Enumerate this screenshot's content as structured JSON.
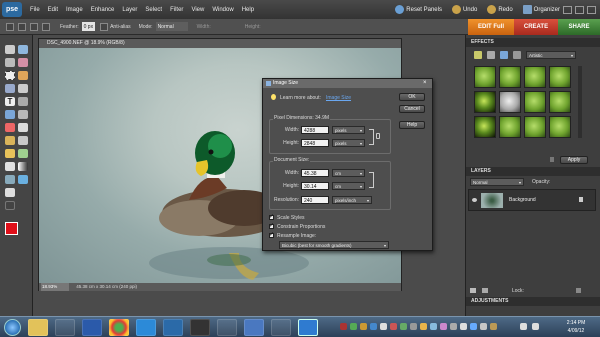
{
  "app": {
    "logo": "pse"
  },
  "menu": [
    "File",
    "Edit",
    "Image",
    "Enhance",
    "Layer",
    "Select",
    "Filter",
    "View",
    "Window",
    "Help"
  ],
  "menu_right": {
    "reset_panels": "Reset Panels",
    "undo": "Undo",
    "redo": "Redo",
    "organizer": "Organizer"
  },
  "options_bar": {
    "feather_label": "Feather:",
    "feather_value": "0 px",
    "antialias": "Anti-alias",
    "mode_label": "Mode:",
    "mode_value": "Normal",
    "width_label": "Width:",
    "height_label": "Height:"
  },
  "modes": {
    "edit": "EDIT Full",
    "create": "CREATE",
    "share": "SHARE"
  },
  "document": {
    "title": "DSC_4900.NEF @ 18.9% (RGB/8)",
    "zoom": "18.93%",
    "status": "45.38 cm x 30.14 cm (240 ppi)"
  },
  "dialog": {
    "title": "Image Size",
    "learn_more": "Learn more about:",
    "learn_more_link": "Image Size",
    "ok": "OK",
    "cancel": "Cancel",
    "help": "Help",
    "pixel_dimensions": "Pixel Dimensions: 34.9M",
    "px_width_label": "Width:",
    "px_width": "4288",
    "px_width_unit": "pixels",
    "px_height_label": "Height:",
    "px_height": "2848",
    "px_height_unit": "pixels",
    "doc_size": "Document Size:",
    "doc_width_label": "Width:",
    "doc_width": "45.38",
    "doc_width_unit": "cm",
    "doc_height_label": "Height:",
    "doc_height": "30.14",
    "doc_height_unit": "cm",
    "res_label": "Resolution:",
    "res_value": "240",
    "res_unit": "pixels/inch",
    "scale_styles": "Scale Styles",
    "constrain": "Constrain Proportions",
    "resample": "Resample Image:",
    "resample_method": "Bicubic (best for smooth gradients)"
  },
  "effects": {
    "header": "EFFECTS",
    "filter": "Artistic",
    "apply": "Apply"
  },
  "layers": {
    "header": "LAYERS",
    "blend": "Normal",
    "opacity_label": "Opacity:",
    "layer_name": "Background",
    "lock_label": "Lock:"
  },
  "adjustments": {
    "header": "ADJUSTMENTS"
  },
  "taskbar": {
    "time": "2:14 PM",
    "date": "4/09/12"
  },
  "colors": {
    "accent_edit": "#e07a1a",
    "create": "#c43a2a",
    "share": "#3f7d3a",
    "foreground": "#e0101a"
  }
}
